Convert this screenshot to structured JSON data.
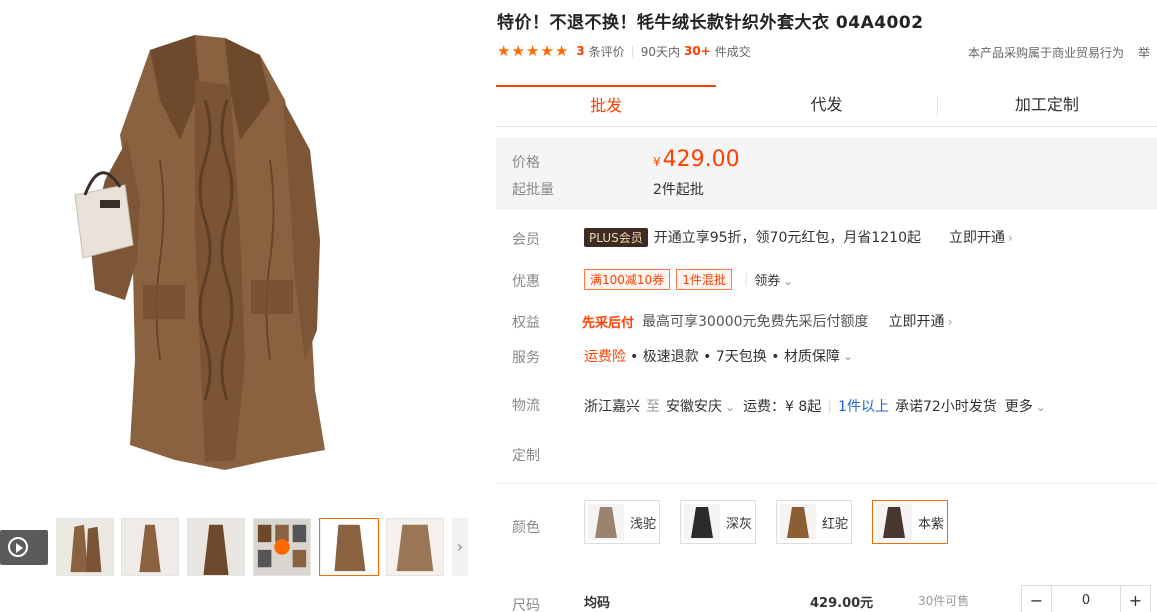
{
  "title": "特价！不退不换！牦牛绒长款针织外套大衣 04A4002",
  "rating": {
    "stars": 5,
    "count": "3",
    "count_suffix": "条评价",
    "period": "90天内",
    "sold": "30+",
    "sold_suffix": "件成交"
  },
  "trade_note": "本产品采购属于商业贸易行为",
  "trade_note_tail": "举",
  "tabs": [
    {
      "label": "批发",
      "active": true
    },
    {
      "label": "代发",
      "active": false
    },
    {
      "label": "加工定制",
      "active": false
    }
  ],
  "price": {
    "label": "价格",
    "currency": "¥",
    "value": "429.00",
    "moq_label": "起批量",
    "moq_value": "2件起批"
  },
  "member": {
    "label": "会员",
    "badge": "PLUS会员",
    "text": "开通立享95折，领70元红包，月省1210起",
    "link": "立即开通"
  },
  "discount": {
    "label": "优惠",
    "coupons": [
      "满100减10券",
      "1件混批"
    ],
    "link": "领券"
  },
  "benefit": {
    "label": "权益",
    "highlight": "先采后付",
    "text": "最高可享30000元免费先采后付额度",
    "link": "立即开通"
  },
  "service": {
    "label": "服务",
    "highlight": "运费险",
    "items": "• 极速退款 • 7天包换 • 材质保障"
  },
  "logistics": {
    "label": "物流",
    "from": "浙江嘉兴",
    "to_word": "至",
    "to": "安徽安庆",
    "fee": "运费：¥ 8起",
    "min": "1件以上",
    "promise": "承诺72小时发货",
    "more": "更多"
  },
  "custom": {
    "label": "定制"
  },
  "colors": {
    "label": "颜色",
    "options": [
      {
        "name": "浅驼",
        "selected": false,
        "swatch": "#9a8470"
      },
      {
        "name": "深灰",
        "selected": false,
        "swatch": "#2b2b2b"
      },
      {
        "name": "红驼",
        "selected": false,
        "swatch": "#8b5e34"
      },
      {
        "name": "本紫",
        "selected": true,
        "swatch": "#4a3630"
      }
    ]
  },
  "size": {
    "label": "尺码",
    "name": "均码",
    "price": "429.00元",
    "stock": "30件可售",
    "qty": "0",
    "minus": "−",
    "plus": "+"
  },
  "product_colors": {
    "coat": "#8a6240",
    "coat_dark": "#6e4a2c",
    "bag": "#e8e2d8",
    "accent": "#ff4000"
  }
}
